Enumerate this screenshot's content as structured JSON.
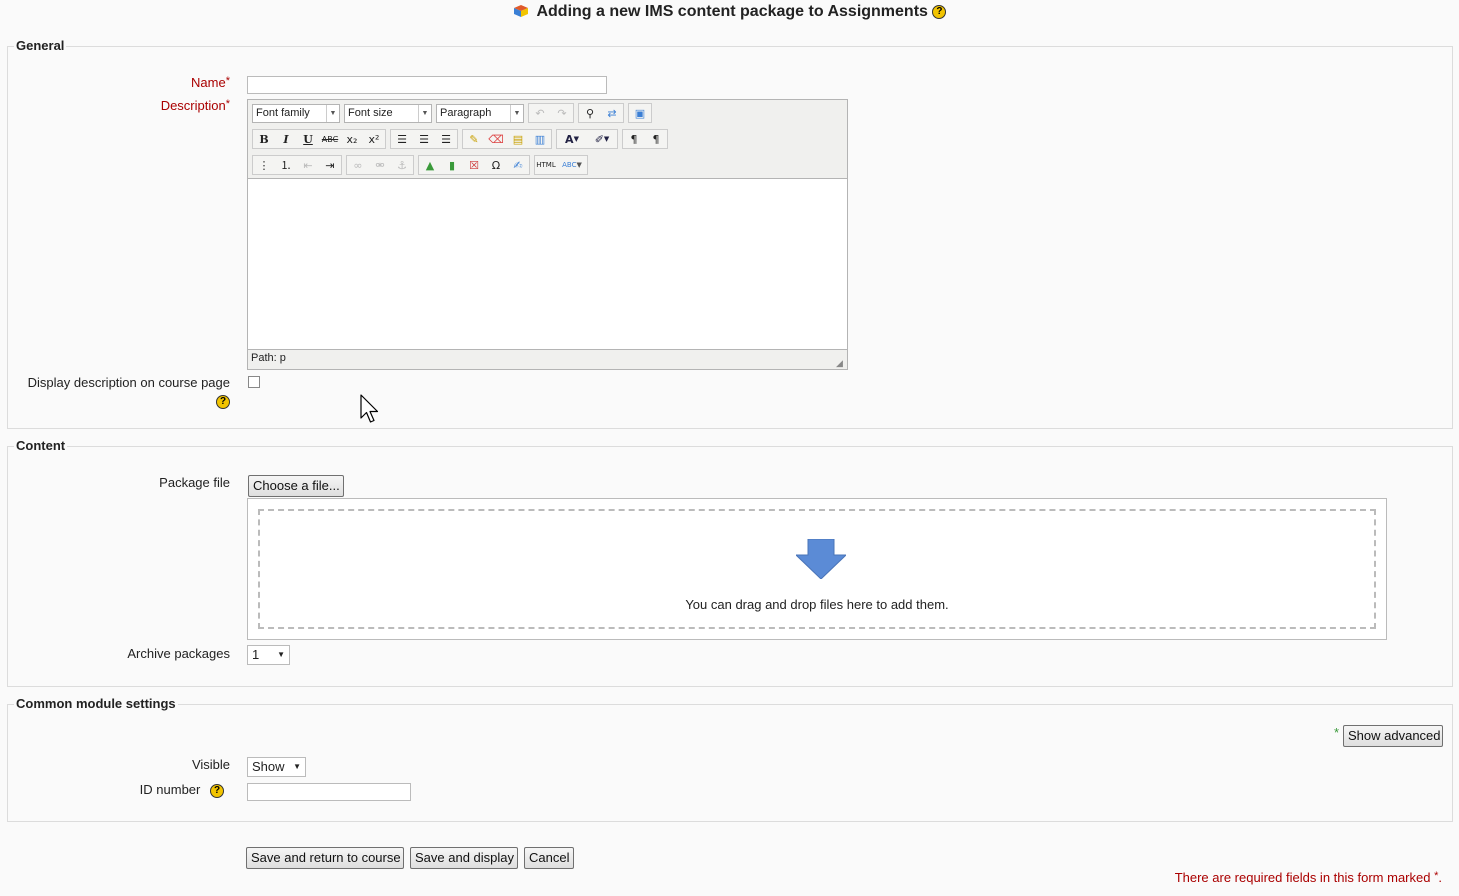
{
  "page": {
    "title": "Adding a new IMS content package to Assignments"
  },
  "general": {
    "legend": "General",
    "name_label": "Name",
    "description_label": "Description",
    "required_marker": "*",
    "editor": {
      "font_family": "Font family",
      "font_size": "Font size",
      "paragraph": "Paragraph",
      "path": "Path: p",
      "buttons": {
        "bold": "B",
        "italic": "I",
        "underline": "U",
        "strike": "ABC",
        "subscript": "x₂",
        "superscript": "x²",
        "html": "HTML",
        "spell": "ABC",
        "omega": "Ω"
      }
    },
    "display_desc_label": "Display description on course page",
    "display_desc_checked": false
  },
  "content": {
    "legend": "Content",
    "package_file_label": "Package file",
    "choose_button": "Choose a file...",
    "drop_text": "You can drag and drop files here to add them.",
    "archive_label": "Archive packages",
    "archive_value": "1"
  },
  "common": {
    "legend": "Common module settings",
    "advanced_marker": "*",
    "show_advanced": "Show advanced",
    "visible_label": "Visible",
    "visible_value": "Show",
    "idnumber_label": "ID number"
  },
  "actions": {
    "save_return": "Save and return to course",
    "save_display": "Save and display",
    "cancel": "Cancel"
  },
  "required_note": {
    "text": "There are required fields in this form marked",
    "marker": "*",
    "end": "."
  },
  "colors": {
    "required_red": "#aa0000",
    "help_yellow": "#f2c400",
    "drop_arrow_blue": "#5b8bd6",
    "advanced_green": "#3a9a3a"
  },
  "icons": [
    "module-icon",
    "help-icon",
    "drop-arrow-icon",
    "mouse-cursor-icon"
  ]
}
